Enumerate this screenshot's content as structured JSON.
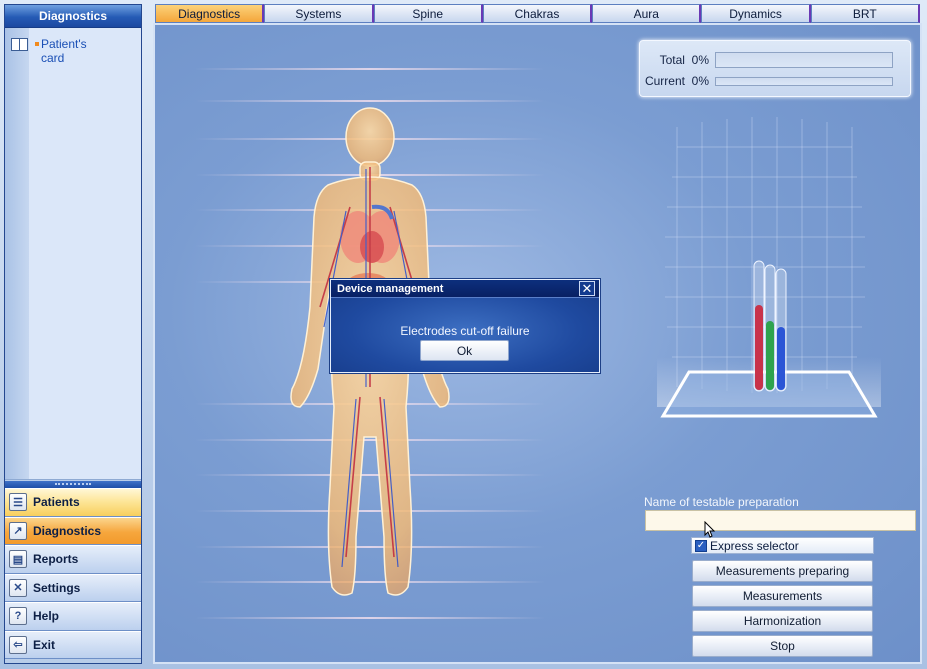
{
  "sidebar": {
    "title": "Diagnostics",
    "tree": [
      {
        "label": "Patient's card",
        "icon": "book-icon"
      }
    ],
    "nav": [
      {
        "label": "Patients",
        "icon": "patients-icon"
      },
      {
        "label": "Diagnostics",
        "icon": "chart-icon",
        "active": true
      },
      {
        "label": "Reports",
        "icon": "printer-icon"
      },
      {
        "label": "Settings",
        "icon": "tools-icon"
      },
      {
        "label": "Help",
        "icon": "help-icon"
      },
      {
        "label": "Exit",
        "icon": "exit-icon"
      }
    ]
  },
  "tabs": [
    "Diagnostics",
    "Systems",
    "Spine",
    "Chakras",
    "Aura",
    "Dynamics",
    "BRT"
  ],
  "active_tab": "Diagnostics",
  "progress": {
    "total_label": "Total",
    "total_value": "0%",
    "total_fraction": 0,
    "current_label": "Current",
    "current_value": "0%",
    "current_fraction": 0
  },
  "preparation": {
    "label": "Name of testable preparation",
    "value": ""
  },
  "express_selector": {
    "label": "Express selector",
    "checked": true
  },
  "buttons": {
    "measurements_preparing": "Measurements preparing",
    "measurements": "Measurements",
    "harmonization": "Harmonization",
    "stop": "Stop"
  },
  "dialog": {
    "title": "Device management",
    "message": "Electrodes cut-off failure",
    "ok": "Ok",
    "close_icon": "close-icon"
  },
  "colors": {
    "accent_tab": "#f4a63b",
    "panel_blue": "#7b9dd2",
    "dialog_blue": "#1f4aa0",
    "tube_red": "#c8334a",
    "tube_green": "#2fa34e",
    "tube_blue": "#2b55d6"
  }
}
